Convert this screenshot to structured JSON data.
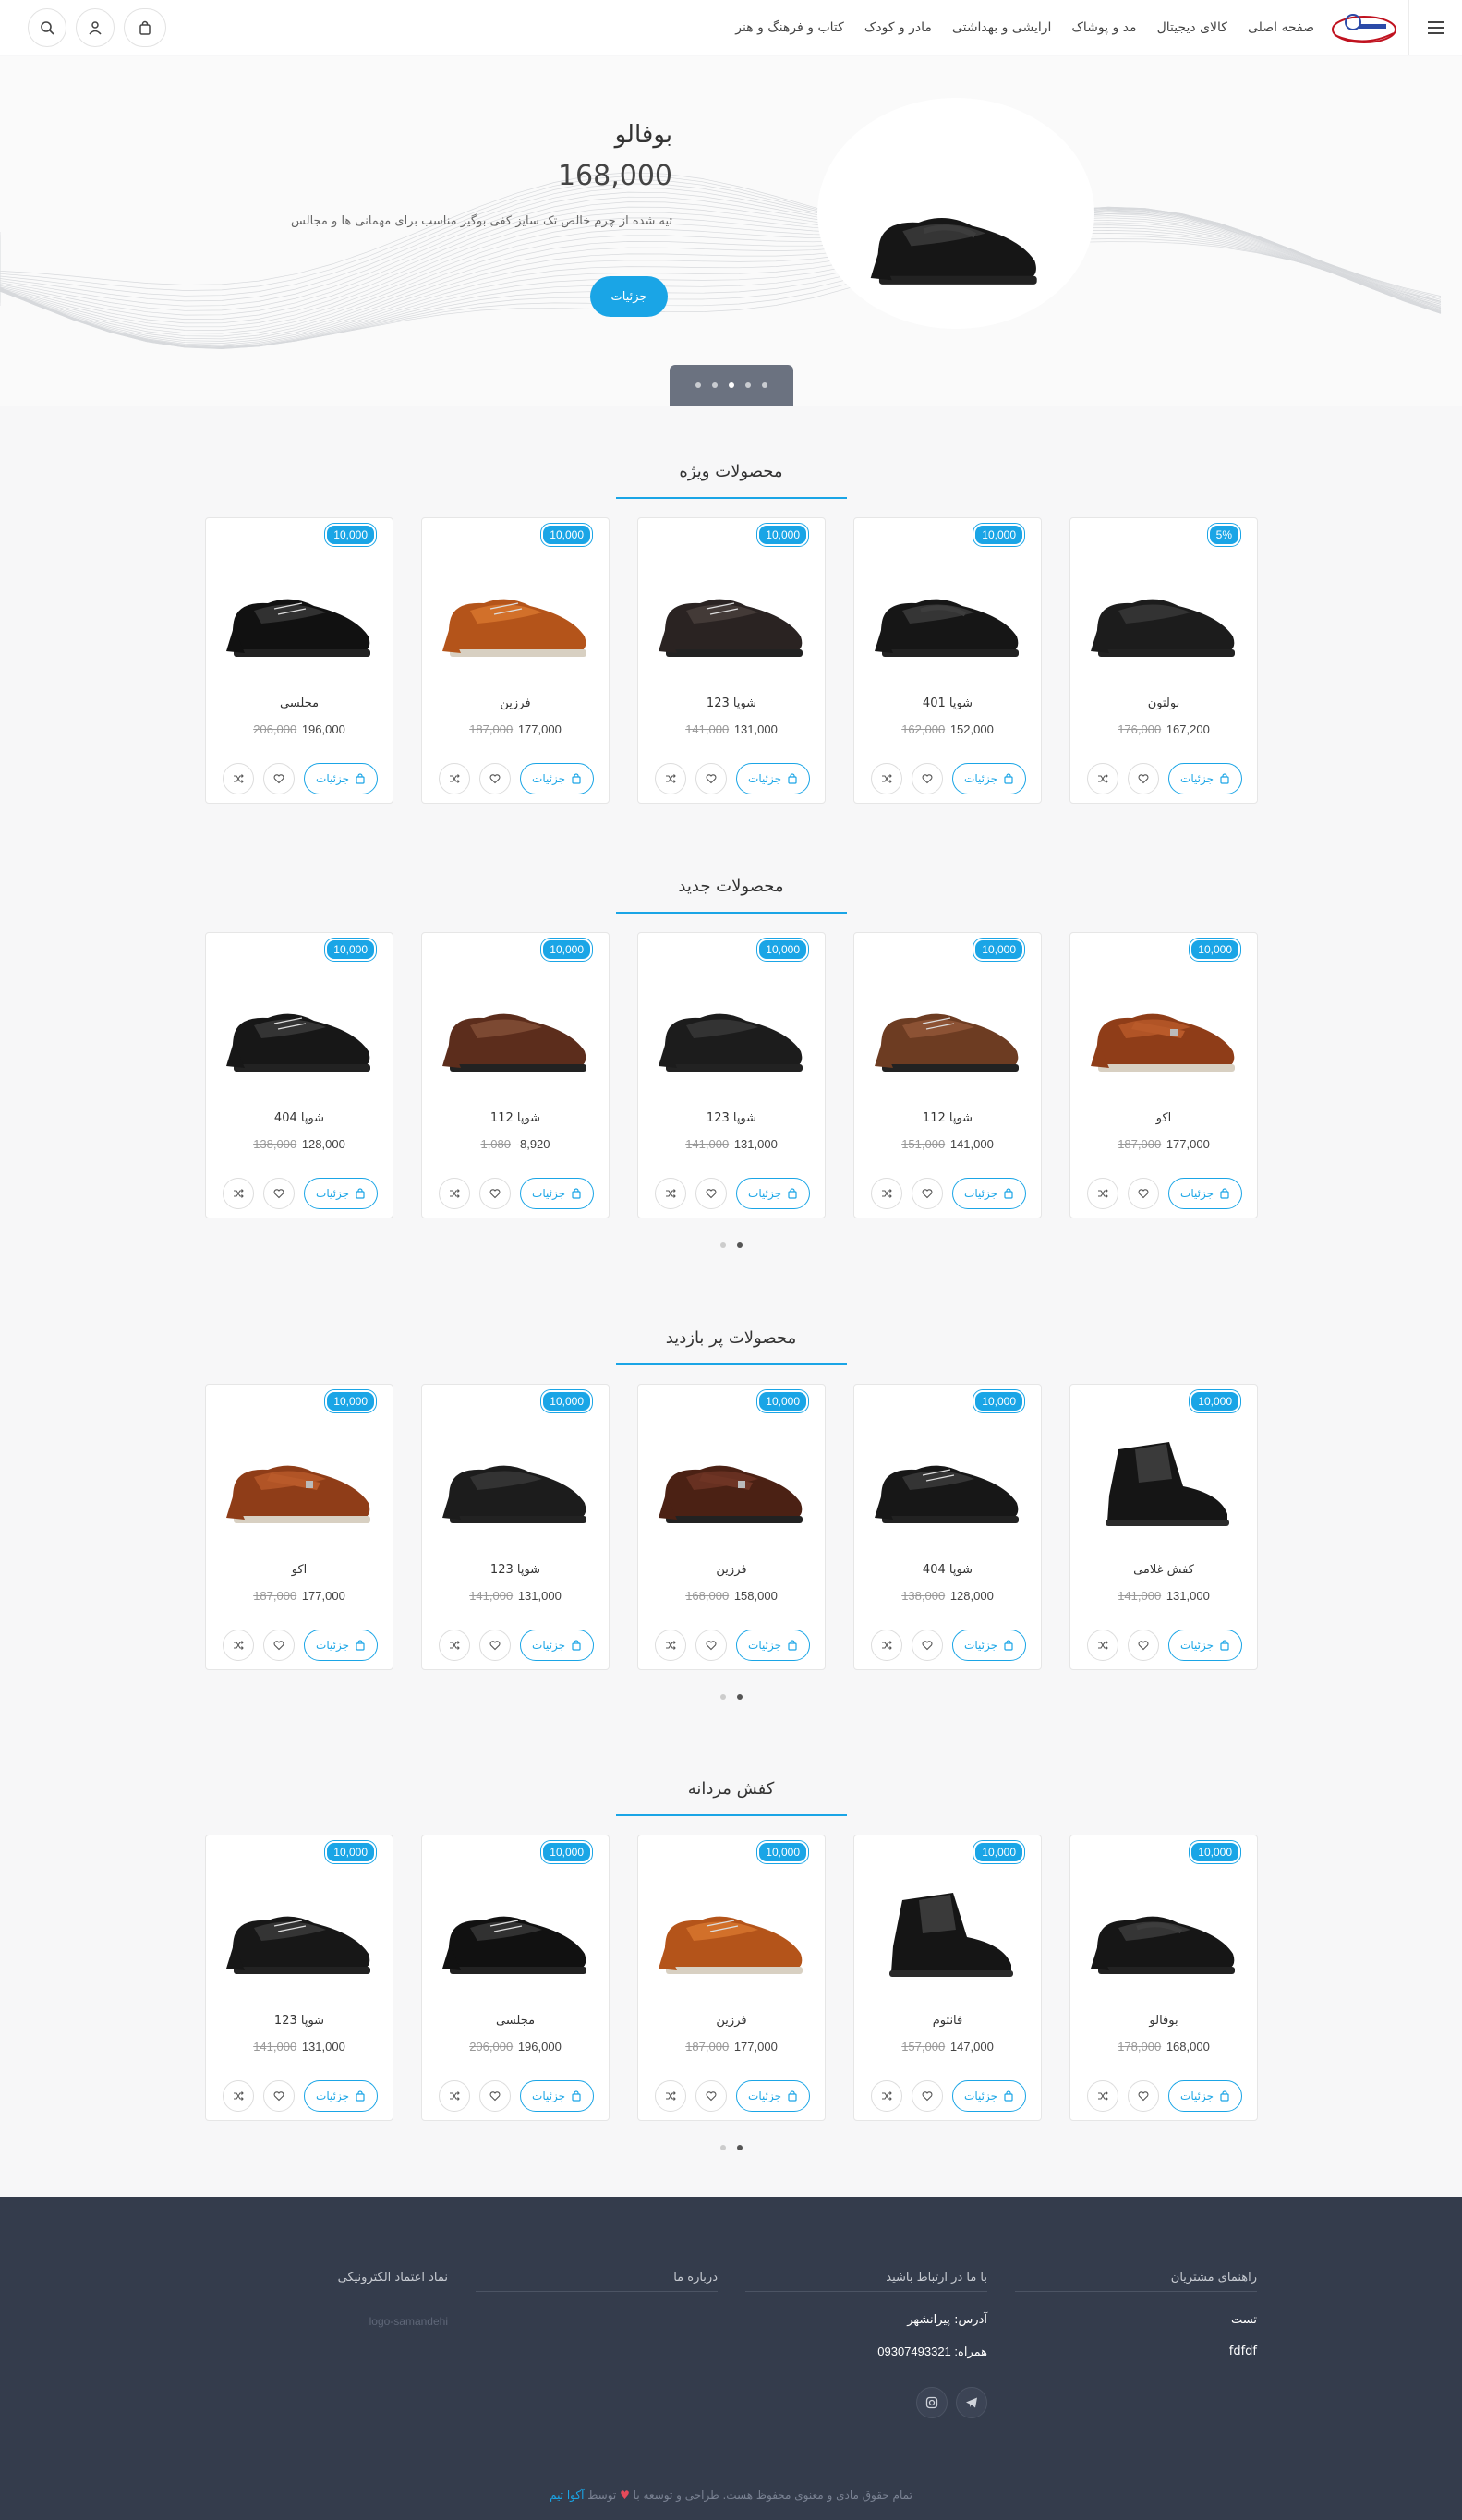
{
  "nav": {
    "items": [
      "صفحه اصلی",
      "کالای دیجیتال",
      "مد و پوشاک",
      "ارایشی و بهداشتی",
      "مادر و کودک",
      "کتاب و فرهنگ و هنر"
    ]
  },
  "hero": {
    "title": "بوفالو",
    "price": "168,000",
    "description": "تیه شده از چرم خالص تک سایز کفی بوگیر مناسب برای مهمانی ها و مجالس",
    "button": "جزئیات",
    "slides": 5,
    "active_slide": 2
  },
  "sections": [
    {
      "title": "محصولات ویژه",
      "pager": false,
      "products": [
        {
          "badge": "5%",
          "name": "بولتون",
          "price": "167,200",
          "old": "176,000",
          "shoe": "slipon-black"
        },
        {
          "badge": "10,000",
          "name": "شوپا 401",
          "price": "152,000",
          "old": "162,000",
          "shoe": "loafer-black"
        },
        {
          "badge": "10,000",
          "name": "شوپا 123",
          "price": "131,000",
          "old": "141,000",
          "shoe": "lace-dark"
        },
        {
          "badge": "10,000",
          "name": "فرزین",
          "price": "177,000",
          "old": "187,000",
          "shoe": "lace-brown"
        },
        {
          "badge": "10,000",
          "name": "مجلسی",
          "price": "196,000",
          "old": "206,000",
          "shoe": "oxford-black"
        }
      ]
    },
    {
      "title": "محصولات جدید",
      "pager": true,
      "products": [
        {
          "badge": "10,000",
          "name": "اکو",
          "price": "177,000",
          "old": "187,000",
          "shoe": "strap-brown"
        },
        {
          "badge": "10,000",
          "name": "شوپا 112",
          "price": "141,000",
          "old": "151,000",
          "shoe": "lace-brown2"
        },
        {
          "badge": "10,000",
          "name": "شوپا 123",
          "price": "131,000",
          "old": "141,000",
          "shoe": "slipon-black"
        },
        {
          "badge": "10,000",
          "name": "شوپا 112",
          "price": "8,920-",
          "old": "1,080",
          "shoe": "slipon-brown"
        },
        {
          "badge": "10,000",
          "name": "شوپا 404",
          "price": "128,000",
          "old": "138,000",
          "shoe": "lace-black"
        }
      ]
    },
    {
      "title": "محصولات پر بازدید",
      "pager": true,
      "products": [
        {
          "badge": "10,000",
          "name": "کفش غلامی",
          "price": "131,000",
          "old": "141,000",
          "shoe": "boot-black"
        },
        {
          "badge": "10,000",
          "name": "شوپا 404",
          "price": "128,000",
          "old": "138,000",
          "shoe": "lace-black"
        },
        {
          "badge": "10,000",
          "name": "فرزین",
          "price": "158,000",
          "old": "168,000",
          "shoe": "strap-darkbrown"
        },
        {
          "badge": "10,000",
          "name": "شوپا 123",
          "price": "131,000",
          "old": "141,000",
          "shoe": "slipon-black"
        },
        {
          "badge": "10,000",
          "name": "اکو",
          "price": "177,000",
          "old": "187,000",
          "shoe": "strap-brown"
        }
      ]
    },
    {
      "title": "کفش مردانه",
      "pager": true,
      "products": [
        {
          "badge": "10,000",
          "name": "بوفالو",
          "price": "168,000",
          "old": "178,000",
          "shoe": "loafer-black"
        },
        {
          "badge": "10,000",
          "name": "فانتوم",
          "price": "147,000",
          "old": "157,000",
          "shoe": "boot-black"
        },
        {
          "badge": "10,000",
          "name": "فرزین",
          "price": "177,000",
          "old": "187,000",
          "shoe": "lace-brown"
        },
        {
          "badge": "10,000",
          "name": "مجلسی",
          "price": "196,000",
          "old": "206,000",
          "shoe": "oxford-black"
        },
        {
          "badge": "10,000",
          "name": "شوپا 123",
          "price": "131,000",
          "old": "141,000",
          "shoe": "lace-black"
        }
      ]
    }
  ],
  "card_button": "جزئیات",
  "footer": {
    "col1_title": "راهنمای مشتریان",
    "col1_items": [
      "تست",
      "fdfdf"
    ],
    "col2_title": "با ما در ارتباط باشید",
    "address_label": "آدرس:",
    "address": "پیرانشهر",
    "phone_label": "همراه:",
    "phone": "09307493321",
    "col3_title": "درباره ما",
    "col4_title": "نماد اعتماد الکترونیکی",
    "col4_placeholder": "logo-samandehi",
    "copyright_prefix": "تمام حقوق مادی و معنوی محفوظ هست. طراحی و توسعه با",
    "copyright_by": "توسط",
    "copyright_brand": "آکوا تیم"
  },
  "colors": {
    "accent": "#1aa5e6",
    "footer": "#343c4c"
  }
}
